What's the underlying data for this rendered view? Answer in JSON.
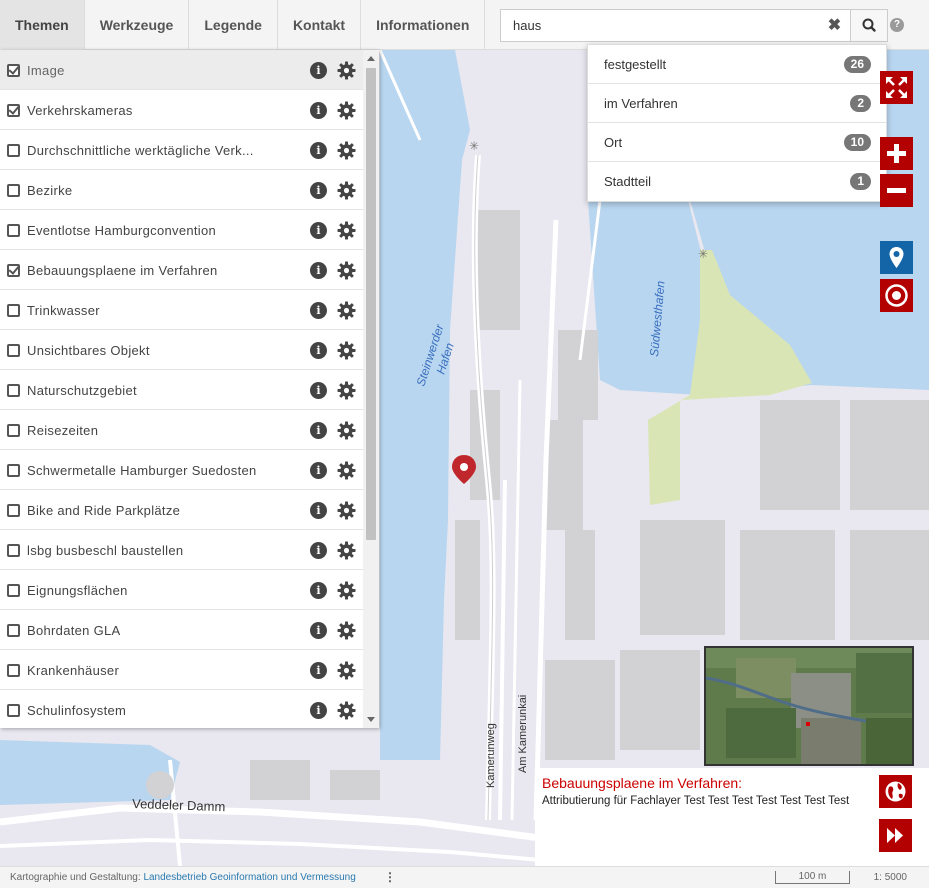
{
  "tabs": [
    {
      "label": "Themen",
      "active": true
    },
    {
      "label": "Werkzeuge"
    },
    {
      "label": "Legende"
    },
    {
      "label": "Kontakt"
    },
    {
      "label": "Informationen"
    }
  ],
  "search": {
    "value": "haus",
    "clear_icon": "close-icon",
    "button_icon": "search-icon"
  },
  "help_icon": "question-circle-icon",
  "dropdown": [
    {
      "label": "festgestellt",
      "count": "26"
    },
    {
      "label": "im Verfahren",
      "count": "2"
    },
    {
      "label": "Ort",
      "count": "10"
    },
    {
      "label": "Stadtteil",
      "count": "1"
    }
  ],
  "layers": [
    {
      "name": "Image",
      "checked": true
    },
    {
      "name": "Verkehrskameras",
      "checked": true
    },
    {
      "name": "Durchschnittliche werktägliche Verk...",
      "checked": false
    },
    {
      "name": "Bezirke",
      "checked": false
    },
    {
      "name": "Eventlotse Hamburgconvention",
      "checked": false
    },
    {
      "name": "Bebauungsplaene im Verfahren",
      "checked": true
    },
    {
      "name": "Trinkwasser",
      "checked": false
    },
    {
      "name": "Unsichtbares Objekt",
      "checked": false
    },
    {
      "name": "Naturschutzgebiet",
      "checked": false
    },
    {
      "name": "Reisezeiten",
      "checked": false
    },
    {
      "name": "Schwermetalle Hamburger Suedosten",
      "checked": false
    },
    {
      "name": "Bike and Ride Parkplätze",
      "checked": false
    },
    {
      "name": "lsbg busbeschl baustellen",
      "checked": false
    },
    {
      "name": "Eignungsflächen",
      "checked": false
    },
    {
      "name": "Bohrdaten GLA",
      "checked": false
    },
    {
      "name": "Krankenhäuser",
      "checked": false
    },
    {
      "name": "Schulinfosystem",
      "checked": false
    }
  ],
  "layer_icons": {
    "info": "info-circle-icon",
    "settings": "gear-icon"
  },
  "map": {
    "labels": {
      "steinwerder_1": "Steinwerder",
      "steinwerder_2": "Hafen",
      "suedwesthafen": "Südwesthafen",
      "kamerunweg": "Kamerunweg",
      "am_kamerunkai": "Am Kamerunkai",
      "veddeler_damm": "Veddeler Damm"
    },
    "controls": [
      "fullscreen-icon",
      "zoom-in-icon",
      "zoom-out-icon",
      "location-pin-icon",
      "target-icon"
    ],
    "colors": {
      "water": "#b8d6f0",
      "land": "#e9e7ef",
      "park": "#d9e5b4",
      "building": "#d2d1d4",
      "accent": "#b30000",
      "blue_accent": "#1464a8"
    }
  },
  "attribution": {
    "title": "Bebauungsplaene im Verfahren:",
    "text": "Attributierung für Fachlayer Test Test Test Test Test Test Test"
  },
  "footer": {
    "prefix": "Kartographie und Gestaltung: ",
    "link": "Landesbetrieb Geoinformation und Vermessung",
    "scale_bar": "100 m",
    "scale": "1: 5000"
  }
}
